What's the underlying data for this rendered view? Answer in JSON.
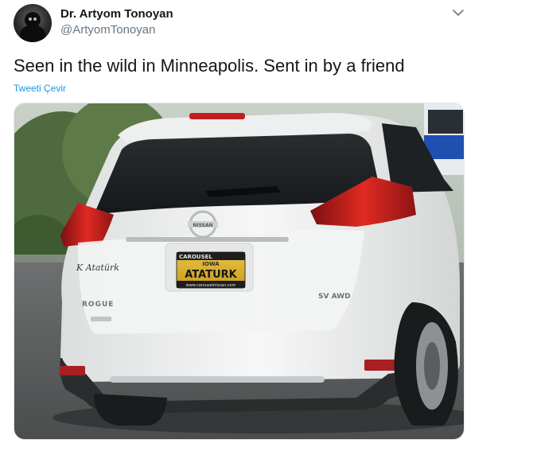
{
  "tweet": {
    "author_name": "Dr. Artyom Tonoyan",
    "author_handle": "@ArtyomTonoyan",
    "text": "Seen in the wild in Minneapolis. Sent in by a friend",
    "translate_label": "Tweeti Çevir",
    "menu_icon": "chevron-down-icon"
  },
  "photo": {
    "plate_top": "CAROUSEL",
    "plate_state": "IOWA",
    "plate_number": "ATATURK",
    "plate_bottom": "www.carouselnissan.com",
    "badge_brand": "NISSAN",
    "badge_model": "ROGUE",
    "badge_awd": "SV AWD",
    "signature": "K Atatürk"
  },
  "colors": {
    "accent": "#1b95e0",
    "text": "#14171a",
    "muted": "#657786"
  }
}
